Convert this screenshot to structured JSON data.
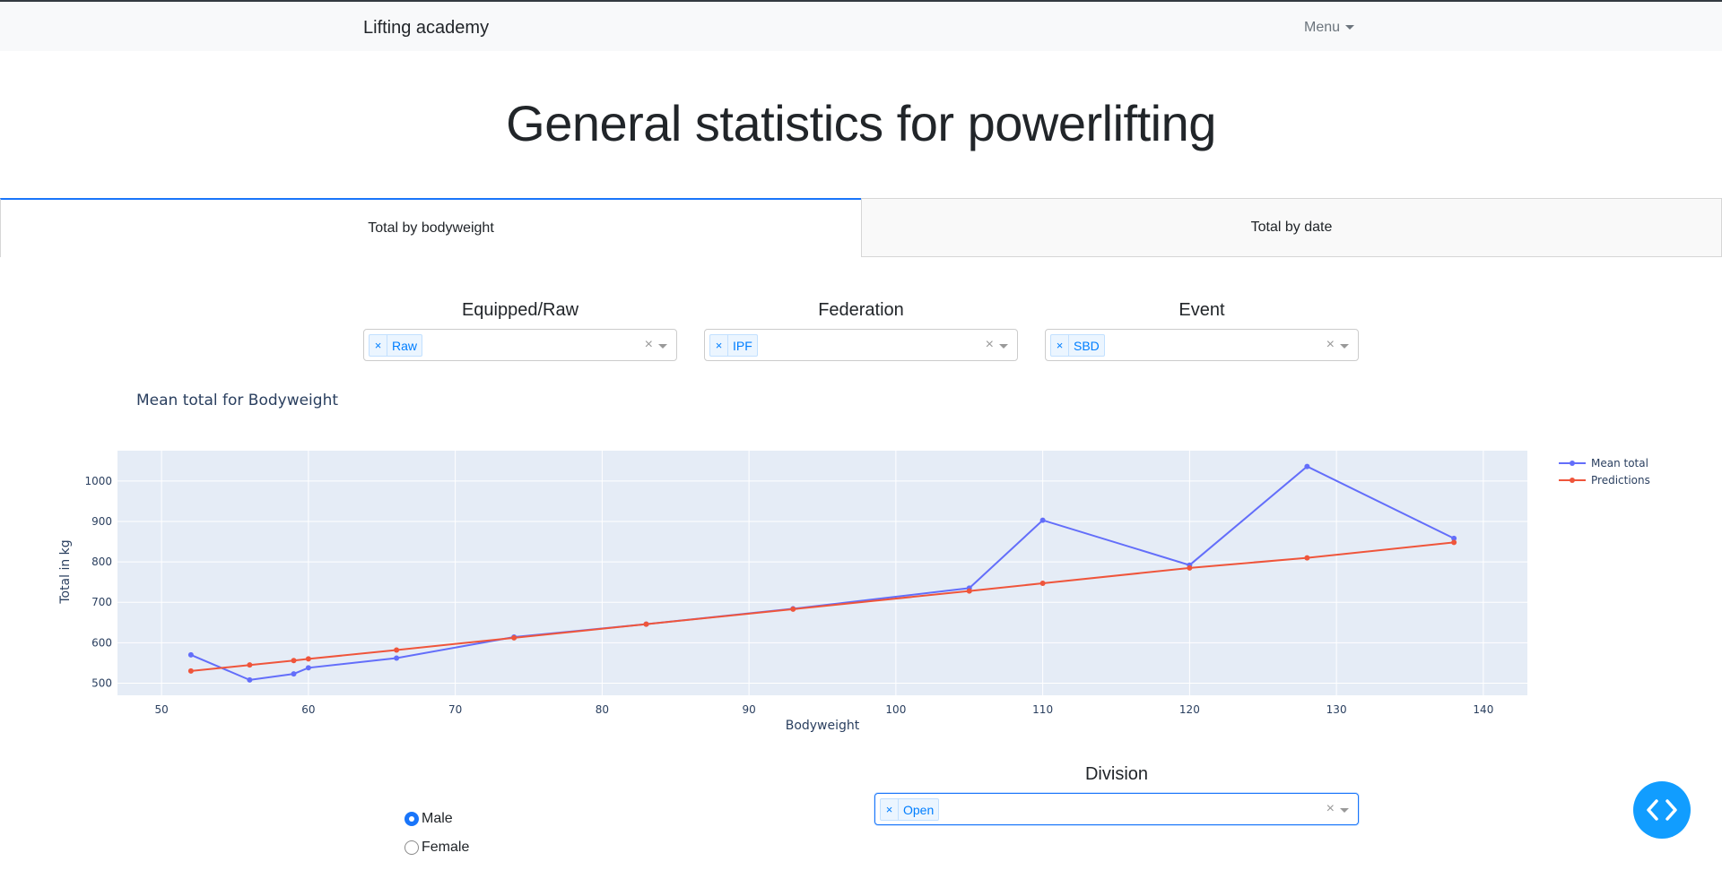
{
  "navbar": {
    "brand": "Lifting academy",
    "menu_label": "Menu"
  },
  "page": {
    "title": "General statistics for powerlifting"
  },
  "tabs": [
    {
      "label": "Total by bodyweight",
      "active": true
    },
    {
      "label": "Total by date",
      "active": false
    }
  ],
  "filters": {
    "equipped": {
      "label": "Equipped/Raw",
      "selected": "Raw",
      "remove": "×",
      "clear": "×"
    },
    "federation": {
      "label": "Federation",
      "selected": "IPF",
      "remove": "×",
      "clear": "×"
    },
    "event": {
      "label": "Event",
      "selected": "SBD",
      "remove": "×",
      "clear": "×"
    },
    "division": {
      "label": "Division",
      "selected": "Open",
      "remove": "×",
      "clear": "×"
    }
  },
  "sex_options": [
    {
      "label": "Male",
      "checked": true
    },
    {
      "label": "Female",
      "checked": false
    }
  ],
  "colors": {
    "accent": "#1975fa",
    "plot_bg": "#e5ecf6",
    "mean_total": "#636efa",
    "predictions": "#ef553b",
    "fab": "#119dff"
  },
  "icons": {
    "fab": "code-brackets-icon",
    "tag_remove": "close-icon",
    "clear": "clear-icon",
    "dropdown": "chevron-down-icon"
  },
  "chart_data": {
    "type": "line",
    "title": "Mean total for Bodyweight",
    "xlabel": "Bodyweight",
    "ylabel": "Total in kg",
    "xlim": [
      47,
      143
    ],
    "ylim": [
      470,
      1075
    ],
    "xticks": [
      50,
      60,
      70,
      80,
      90,
      100,
      110,
      120,
      130,
      140
    ],
    "yticks": [
      500,
      600,
      700,
      800,
      900,
      1000
    ],
    "grid": true,
    "legend_position": "top-right",
    "series": [
      {
        "name": "Mean total",
        "color": "#636efa",
        "x": [
          52,
          56,
          59,
          60,
          66,
          74,
          83,
          93,
          105,
          110,
          120,
          128,
          138
        ],
        "y": [
          570,
          508,
          523,
          538,
          562,
          614,
          646,
          684,
          735,
          903,
          792,
          1036,
          858
        ]
      },
      {
        "name": "Predictions",
        "color": "#ef553b",
        "x": [
          52,
          56,
          59,
          60,
          66,
          74,
          83,
          93,
          105,
          110,
          120,
          128,
          138
        ],
        "y": [
          530,
          545,
          556,
          560,
          582,
          612,
          646,
          683,
          728,
          747,
          785,
          810,
          848
        ]
      }
    ]
  }
}
